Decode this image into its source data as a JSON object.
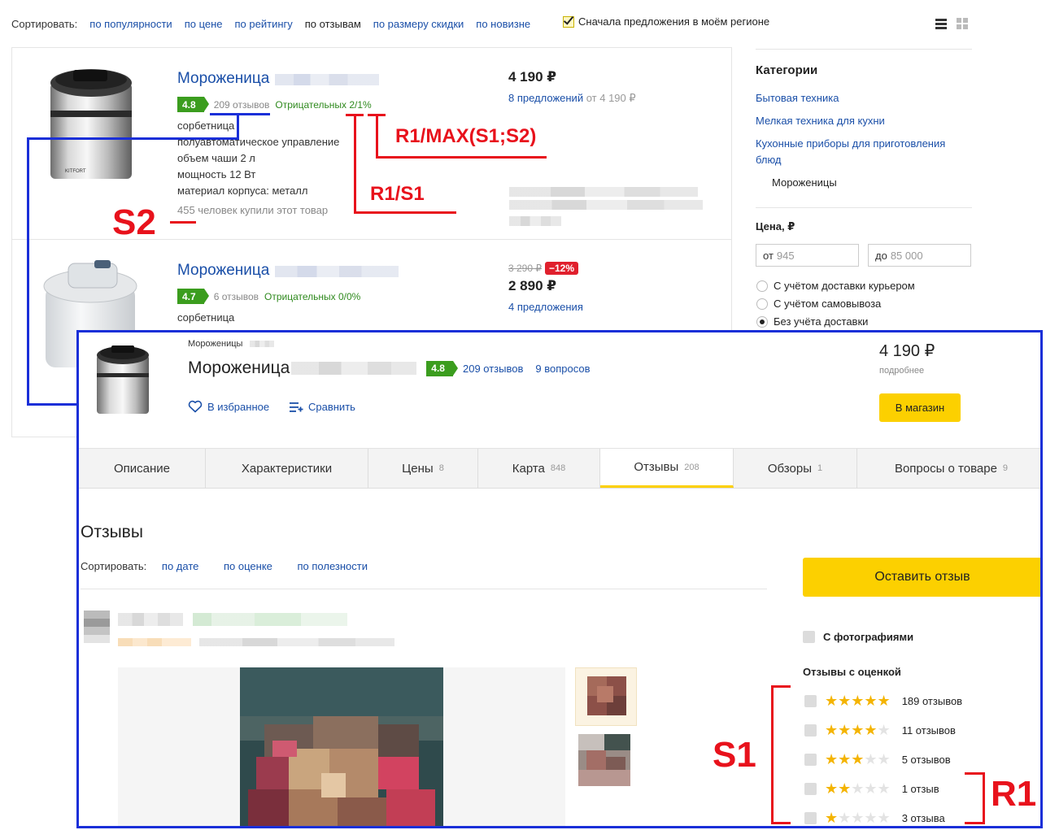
{
  "sort": {
    "label": "Сортировать:",
    "options": [
      "по популярности",
      "по цене",
      "по рейтингу",
      "по отзывам",
      "по размеру скидки",
      "по новизне"
    ],
    "active_index": 3,
    "region_label": "Сначала предложения в моём регионе",
    "region_checked": true
  },
  "products": [
    {
      "title": "Мороженица",
      "rating": "4.8",
      "reviews": "209 отзывов",
      "negative": "Отрицательных 2/1%",
      "specs": [
        "сорбетница",
        "полуавтоматическое управление",
        "объем чаши 2 л",
        "мощность 12 Вт",
        "материал корпуса: металл"
      ],
      "bought": "455 человек купили этот товар",
      "price": "4 190 ₽",
      "offers": "8 предложений",
      "offers_from": "от 4 190 ₽"
    },
    {
      "title": "Мороженица",
      "rating": "4.7",
      "reviews": "6 отзывов",
      "negative": "Отрицательных 0/0%",
      "specs": [
        "сорбетница"
      ],
      "old_price": "3 290 ₽",
      "discount": "−12%",
      "price": "2 890 ₽",
      "offers": "4 предложения"
    }
  ],
  "sidebar": {
    "categories_title": "Категории",
    "categories": [
      "Бытовая техника",
      "Мелкая техника для кухни",
      "Кухонные приборы для приготовления блюд"
    ],
    "current": "Мороженицы",
    "price_title": "Цена, ₽",
    "from_prefix": "от",
    "from_placeholder": "945",
    "to_prefix": "до",
    "to_placeholder": "85 000",
    "delivery": [
      {
        "label": "С учётом доставки курьером",
        "selected": false
      },
      {
        "label": "С учётом самовывоза",
        "selected": false
      },
      {
        "label": "Без учёта доставки",
        "selected": true
      }
    ]
  },
  "annotations": {
    "r1_max": "R1/MAX(S1;S2)",
    "r1_s1": "R1/S1",
    "s2": "S2",
    "s1": "S1",
    "r1": "R1"
  },
  "card": {
    "breadcrumb": "Мороженицы",
    "title": "Мороженица",
    "rating": "4.8",
    "reviews_link": "209 отзывов",
    "questions_link": "9 вопросов",
    "favorite": "В избранное",
    "compare": "Сравнить",
    "price": "4 190 ₽",
    "more": "подробнее",
    "shop_button": "В магазин",
    "tabs": [
      {
        "label": "Описание",
        "count": ""
      },
      {
        "label": "Характеристики",
        "count": ""
      },
      {
        "label": "Цены",
        "count": "8"
      },
      {
        "label": "Карта",
        "count": "848"
      },
      {
        "label": "Отзывы",
        "count": "208"
      },
      {
        "label": "Обзоры",
        "count": "1"
      },
      {
        "label": "Вопросы о товаре",
        "count": "9"
      }
    ],
    "active_tab": 4,
    "reviews_title": "Отзывы",
    "reviews_sort_label": "Сортировать:",
    "reviews_sort": [
      "по дате",
      "по оценке",
      "по полезности"
    ],
    "leave_review": "Оставить отзыв",
    "with_photos": "С фотографиями",
    "by_rating_title": "Отзывы с оценкой",
    "rating_filters": [
      {
        "stars": 5,
        "count": "189 отзывов"
      },
      {
        "stars": 4,
        "count": "11 отзывов"
      },
      {
        "stars": 3,
        "count": "5 отзывов"
      },
      {
        "stars": 2,
        "count": "1 отзыв"
      },
      {
        "stars": 1,
        "count": "3 отзыва"
      }
    ]
  },
  "colors": {
    "link": "#1a4fa8",
    "rating_green": "#3b9d1e",
    "accent_yellow": "#fcd000",
    "annotation_blue": "#1a2fd8",
    "annotation_red": "#e8121c",
    "discount_red": "#e0202d",
    "star": "#f4b400"
  }
}
